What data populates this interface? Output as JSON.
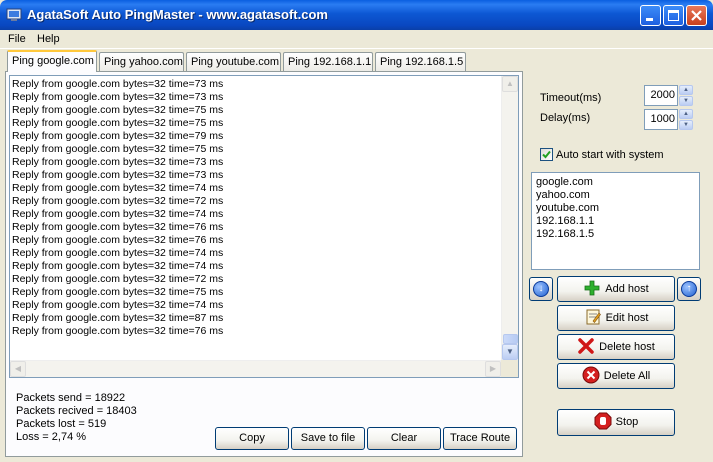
{
  "window": {
    "title": "AgataSoft Auto PingMaster  -  www.agatasoft.com",
    "icon": "ping-app-icon"
  },
  "menu": [
    "File",
    "Help"
  ],
  "tabs": [
    {
      "label": "Ping google.com",
      "active": true
    },
    {
      "label": "Ping yahoo.com",
      "active": false
    },
    {
      "label": "Ping youtube.com",
      "active": false
    },
    {
      "label": "Ping 192.168.1.1",
      "active": false
    },
    {
      "label": "Ping 192.168.1.5",
      "active": false
    }
  ],
  "log": [
    "Reply from google.com bytes=32 time=73 ms",
    "Reply from google.com bytes=32 time=73 ms",
    "Reply from google.com bytes=32 time=75 ms",
    "Reply from google.com bytes=32 time=75 ms",
    "Reply from google.com bytes=32 time=79 ms",
    "Reply from google.com bytes=32 time=75 ms",
    "Reply from google.com bytes=32 time=73 ms",
    "Reply from google.com bytes=32 time=73 ms",
    "Reply from google.com bytes=32 time=74 ms",
    "Reply from google.com bytes=32 time=72 ms",
    "Reply from google.com bytes=32 time=74 ms",
    "Reply from google.com bytes=32 time=76 ms",
    "Reply from google.com bytes=32 time=76 ms",
    "Reply from google.com bytes=32 time=74 ms",
    "Reply from google.com bytes=32 time=74 ms",
    "Reply from google.com bytes=32 time=72 ms",
    "Reply from google.com bytes=32 time=75 ms",
    "Reply from google.com bytes=32 time=74 ms",
    "Reply from google.com bytes=32 time=87 ms",
    "Reply from google.com bytes=32 time=76 ms"
  ],
  "stats": {
    "sent": "Packets send = 18922",
    "received": "Packets recived = 18403",
    "lost": "Packets lost = 519",
    "loss": "Loss = 2,74 %"
  },
  "buttons": {
    "copy": "Copy",
    "save": "Save to file",
    "clear": "Clear",
    "trace": "Trace Route"
  },
  "settings": {
    "timeout_label": "Timeout(ms)",
    "timeout_value": "2000",
    "delay_label": "Delay(ms)",
    "delay_value": "1000",
    "autostart_label": "Auto start with system",
    "autostart_checked": true
  },
  "hosts": [
    "google.com",
    "yahoo.com",
    "youtube.com",
    "192.168.1.1",
    "192.168.1.5"
  ],
  "host_buttons": {
    "add": "Add host",
    "edit": "Edit host",
    "delete": "Delete host",
    "delete_all": "Delete All",
    "stop": "Stop"
  },
  "icons": {
    "move_down": "arrow-down-icon",
    "move_up": "arrow-up-icon",
    "add": "plus-icon",
    "edit": "notepad-icon",
    "delete": "red-x-icon",
    "delete_all": "delete-all-icon",
    "stop": "stop-hand-icon"
  }
}
